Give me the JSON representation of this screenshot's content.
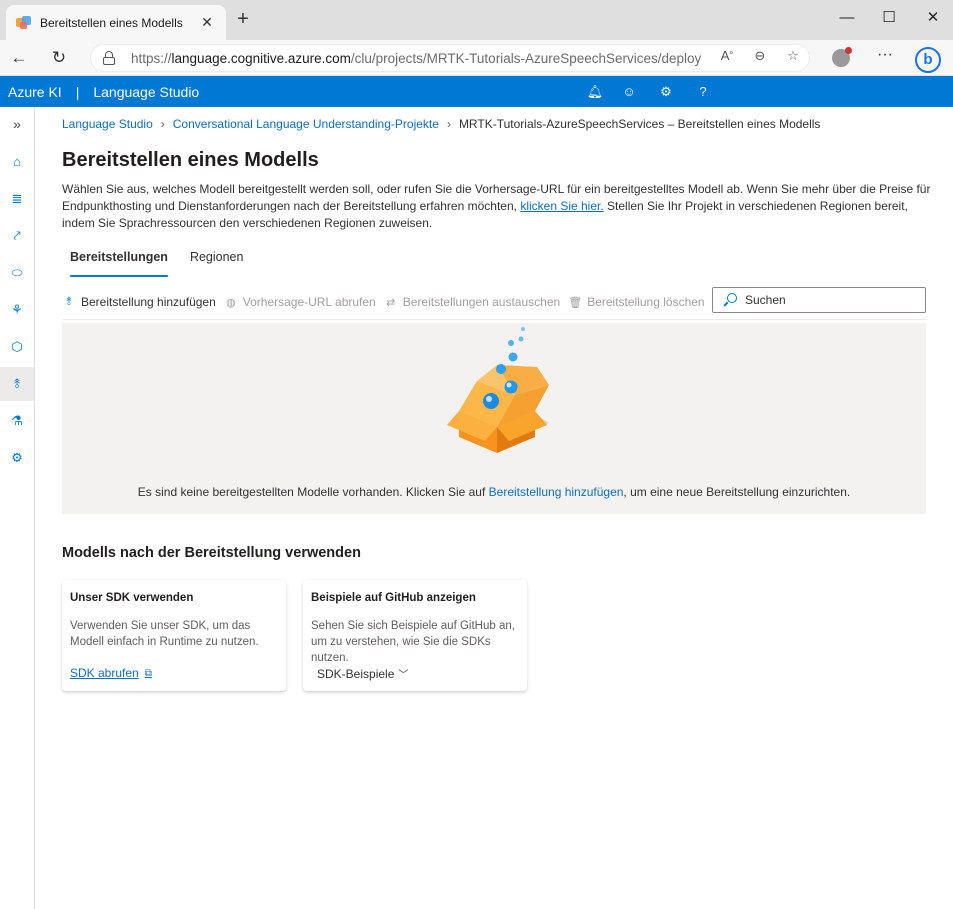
{
  "browser": {
    "tab_title": "Bereitstellen eines Modells",
    "url_prefix": "https://",
    "url_host": "language.cognitive.azure.com",
    "url_path": "/clu/projects/MRTK-Tutorials-AzureSpeechServices/deploy"
  },
  "app": {
    "brand": "Azure KI",
    "separator": "|",
    "studio": "Language Studio"
  },
  "breadcrumb": {
    "items": [
      "Language Studio",
      "Conversational Language Understanding-Projekte"
    ],
    "current": "MRTK-Tutorials-AzureSpeechServices – Bereitstellen eines Modells"
  },
  "page": {
    "title": "Bereitstellen eines Modells",
    "description_part1": "Wählen Sie aus, welches Modell bereitgestellt werden soll, oder rufen Sie die Vorhersage-URL für ein bereitgestelltes Modell ab. Wenn Sie mehr über die Preise für Endpunkthosting und Dienstanforderungen nach der Bereitstellung erfahren möchten, ",
    "description_link": "klicken Sie hier.",
    "description_part2": " Stellen Sie Ihr Projekt in verschiedenen Regionen bereit, indem Sie Sprachressourcen den verschiedenen Regionen zuweisen."
  },
  "tabs": [
    {
      "label": "Bereitstellungen",
      "active": true
    },
    {
      "label": "Regionen",
      "active": false
    }
  ],
  "commands": {
    "add": "Bereitstellung hinzufügen",
    "get_url": "Vorhersage-URL abrufen",
    "swap": "Bereitstellungen austauschen",
    "delete": "Bereitstellung löschen"
  },
  "search": {
    "placeholder": "Suchen"
  },
  "empty_state": {
    "text_before": "Es sind keine bereitgestellten Modelle vorhanden. Klicken Sie auf ",
    "link": "Bereitstellung hinzufügen",
    "text_after": ", um eine neue Bereitstellung einzurichten."
  },
  "usage": {
    "title": "Modells nach der Bereitstellung verwenden",
    "sdk_card": {
      "title": "Unser SDK verwenden",
      "body": "Verwenden Sie unser SDK, um das Modell einfach in Runtime zu nutzen.",
      "link": "SDK abrufen"
    },
    "github_card": {
      "title": "Beispiele auf GitHub anzeigen",
      "body": "Sehen Sie sich Beispiele auf GitHub an, um zu verstehen, wie Sie die SDKs nutzen.",
      "dropdown": "SDK-Beispiele"
    }
  },
  "colors": {
    "accent": "#0078d4",
    "link": "#0f6cbd",
    "panel": "#f3f2f1"
  }
}
